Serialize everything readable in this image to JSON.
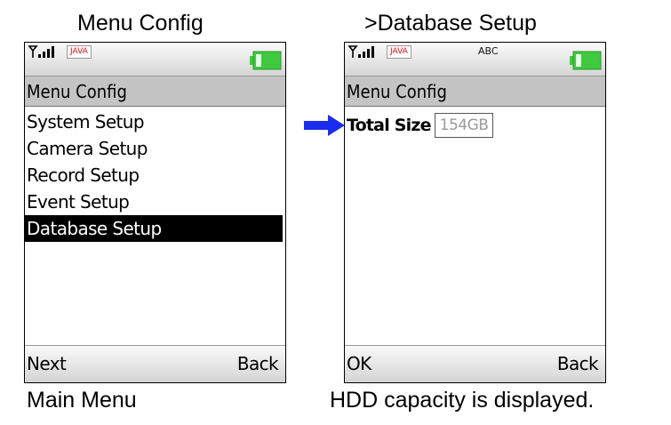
{
  "captions": {
    "left_top": "Menu Config",
    "right_top": ">Database Setup",
    "left_bottom": "Main Menu",
    "right_bottom": "HDD capacity is displayed."
  },
  "colors": {
    "arrow": "#1a2cf0",
    "battery": "#3fc93f",
    "titlebar": "#c4c4c4",
    "selection": "#000000"
  },
  "left_screen": {
    "status": {
      "badge": "JAVA",
      "icons": [
        "signal-icon",
        "java-icon",
        "battery-icon"
      ]
    },
    "title": "Menu Config",
    "menu_items": [
      {
        "label": "System Setup",
        "selected": false
      },
      {
        "label": "Camera Setup",
        "selected": false
      },
      {
        "label": "Record Setup",
        "selected": false
      },
      {
        "label": "Event Setup",
        "selected": false
      },
      {
        "label": "Database Setup",
        "selected": true
      }
    ],
    "softkeys": {
      "left": "Next",
      "right": "Back"
    }
  },
  "right_screen": {
    "status": {
      "badge": "JAVA",
      "input_mode": "ABC",
      "icons": [
        "signal-icon",
        "java-icon",
        "battery-icon"
      ]
    },
    "title": "Menu Config",
    "field": {
      "label": "Total Size",
      "value": "154GB"
    },
    "softkeys": {
      "left": "OK",
      "right": "Back"
    }
  }
}
